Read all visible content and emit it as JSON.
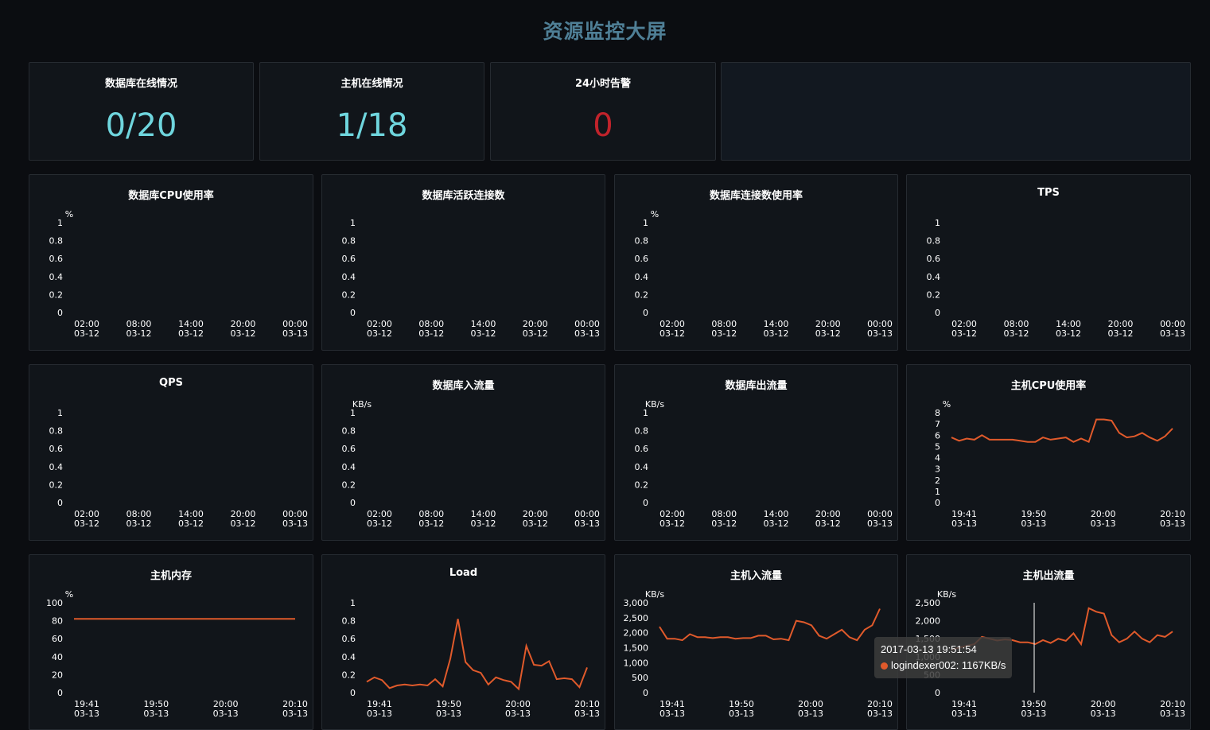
{
  "page": {
    "title": "资源监控大屏"
  },
  "colors": {
    "accent": "#4f7f96",
    "stat_cyan": "#6fd6de",
    "stat_red": "#c1232b",
    "series": "#e05a2b"
  },
  "stats": [
    {
      "label": "数据库在线情况",
      "value": "0/20",
      "color": "#6fd6de"
    },
    {
      "label": "主机在线情况",
      "value": "1/18",
      "color": "#6fd6de"
    },
    {
      "label": "24小时告警",
      "value": "0",
      "color": "#c1232b"
    }
  ],
  "tooltip": {
    "time": "2017-03-13 19:51:54",
    "series": "logindexer002",
    "value": "1167KB/s"
  },
  "chart_data": [
    {
      "type": "line",
      "title": "数据库CPU使用率",
      "unit": "%",
      "y_ticks": [
        "0",
        "0.2",
        "0.4",
        "0.6",
        "0.8",
        "1"
      ],
      "ylim": [
        0,
        1
      ],
      "x_ticks": [
        [
          "02:00",
          "03-12"
        ],
        [
          "08:00",
          "03-12"
        ],
        [
          "14:00",
          "03-12"
        ],
        [
          "20:00",
          "03-12"
        ],
        [
          "00:00",
          "03-13"
        ]
      ],
      "series": []
    },
    {
      "type": "line",
      "title": "数据库活跃连接数",
      "unit": "",
      "y_ticks": [
        "0",
        "0.2",
        "0.4",
        "0.6",
        "0.8",
        "1"
      ],
      "ylim": [
        0,
        1
      ],
      "x_ticks": [
        [
          "02:00",
          "03-12"
        ],
        [
          "08:00",
          "03-12"
        ],
        [
          "14:00",
          "03-12"
        ],
        [
          "20:00",
          "03-12"
        ],
        [
          "00:00",
          "03-13"
        ]
      ],
      "series": []
    },
    {
      "type": "line",
      "title": "数据库连接数使用率",
      "unit": "%",
      "y_ticks": [
        "0",
        "0.2",
        "0.4",
        "0.6",
        "0.8",
        "1"
      ],
      "ylim": [
        0,
        1
      ],
      "x_ticks": [
        [
          "02:00",
          "03-12"
        ],
        [
          "08:00",
          "03-12"
        ],
        [
          "14:00",
          "03-12"
        ],
        [
          "20:00",
          "03-12"
        ],
        [
          "00:00",
          "03-13"
        ]
      ],
      "series": []
    },
    {
      "type": "line",
      "title": "TPS",
      "unit": "",
      "y_ticks": [
        "0",
        "0.2",
        "0.4",
        "0.6",
        "0.8",
        "1"
      ],
      "ylim": [
        0,
        1
      ],
      "x_ticks": [
        [
          "02:00",
          "03-12"
        ],
        [
          "08:00",
          "03-12"
        ],
        [
          "14:00",
          "03-12"
        ],
        [
          "20:00",
          "03-12"
        ],
        [
          "00:00",
          "03-13"
        ]
      ],
      "series": []
    },
    {
      "type": "line",
      "title": "QPS",
      "unit": "",
      "y_ticks": [
        "0",
        "0.2",
        "0.4",
        "0.6",
        "0.8",
        "1"
      ],
      "ylim": [
        0,
        1
      ],
      "x_ticks": [
        [
          "02:00",
          "03-12"
        ],
        [
          "08:00",
          "03-12"
        ],
        [
          "14:00",
          "03-12"
        ],
        [
          "20:00",
          "03-12"
        ],
        [
          "00:00",
          "03-13"
        ]
      ],
      "series": []
    },
    {
      "type": "line",
      "title": "数据库入流量",
      "unit": "KB/s",
      "y_ticks": [
        "0",
        "0.2",
        "0.4",
        "0.6",
        "0.8",
        "1"
      ],
      "ylim": [
        0,
        1
      ],
      "x_ticks": [
        [
          "02:00",
          "03-12"
        ],
        [
          "08:00",
          "03-12"
        ],
        [
          "14:00",
          "03-12"
        ],
        [
          "20:00",
          "03-12"
        ],
        [
          "00:00",
          "03-13"
        ]
      ],
      "series": []
    },
    {
      "type": "line",
      "title": "数据库出流量",
      "unit": "KB/s",
      "y_ticks": [
        "0",
        "0.2",
        "0.4",
        "0.6",
        "0.8",
        "1"
      ],
      "ylim": [
        0,
        1
      ],
      "x_ticks": [
        [
          "02:00",
          "03-12"
        ],
        [
          "08:00",
          "03-12"
        ],
        [
          "14:00",
          "03-12"
        ],
        [
          "20:00",
          "03-12"
        ],
        [
          "00:00",
          "03-13"
        ]
      ],
      "series": []
    },
    {
      "type": "line",
      "title": "主机CPU使用率",
      "unit": "%",
      "y_ticks": [
        "0",
        "1",
        "2",
        "3",
        "4",
        "5",
        "6",
        "7",
        "8"
      ],
      "ylim": [
        0,
        8
      ],
      "x_ticks": [
        [
          "19:41",
          "03-13"
        ],
        [
          "19:50",
          "03-13"
        ],
        [
          "20:00",
          "03-13"
        ],
        [
          "20:10",
          "03-13"
        ]
      ],
      "series": [
        {
          "values": [
            5.8,
            5.5,
            5.7,
            5.6,
            6.0,
            5.6,
            5.6,
            5.6,
            5.6,
            5.5,
            5.4,
            5.4,
            5.8,
            5.6,
            5.7,
            5.8,
            5.4,
            5.7,
            5.4,
            7.4,
            7.4,
            7.3,
            6.2,
            5.8,
            5.9,
            6.2,
            5.8,
            5.5,
            5.9,
            6.6
          ]
        }
      ]
    },
    {
      "type": "line",
      "title": "主机内存",
      "unit": "%",
      "y_ticks": [
        "0",
        "20",
        "40",
        "60",
        "80",
        "100"
      ],
      "ylim": [
        0,
        100
      ],
      "x_ticks": [
        [
          "19:41",
          "03-13"
        ],
        [
          "19:50",
          "03-13"
        ],
        [
          "20:00",
          "03-13"
        ],
        [
          "20:10",
          "03-13"
        ]
      ],
      "series": [
        {
          "values": [
            82,
            82,
            82,
            82,
            82,
            82,
            82,
            82,
            82,
            82,
            82,
            82,
            82,
            82,
            82,
            82,
            82,
            82,
            82,
            82,
            82,
            82,
            82,
            82,
            82,
            82,
            82,
            82,
            82,
            82
          ]
        }
      ]
    },
    {
      "type": "line",
      "title": "Load",
      "unit": "",
      "y_ticks": [
        "0",
        "0.2",
        "0.4",
        "0.6",
        "0.8",
        "1"
      ],
      "ylim": [
        0,
        1
      ],
      "x_ticks": [
        [
          "19:41",
          "03-13"
        ],
        [
          "19:50",
          "03-13"
        ],
        [
          "20:00",
          "03-13"
        ],
        [
          "20:10",
          "03-13"
        ]
      ],
      "series": [
        {
          "values": [
            0.12,
            0.17,
            0.14,
            0.05,
            0.08,
            0.09,
            0.08,
            0.09,
            0.08,
            0.15,
            0.07,
            0.38,
            0.82,
            0.34,
            0.25,
            0.22,
            0.09,
            0.17,
            0.14,
            0.12,
            0.04,
            0.52,
            0.31,
            0.3,
            0.35,
            0.15,
            0.16,
            0.15,
            0.06,
            0.28
          ]
        }
      ]
    },
    {
      "type": "line",
      "title": "主机入流量",
      "unit": "KB/s",
      "y_ticks": [
        "0",
        "500",
        "1,000",
        "1,500",
        "2,000",
        "2,500",
        "3,000"
      ],
      "ylim": [
        0,
        3000
      ],
      "x_ticks": [
        [
          "19:41",
          "03-13"
        ],
        [
          "19:50",
          "03-13"
        ],
        [
          "20:00",
          "03-13"
        ],
        [
          "20:10",
          "03-13"
        ]
      ],
      "series": [
        {
          "values": [
            2200,
            1800,
            1800,
            1750,
            1950,
            1850,
            1850,
            1820,
            1850,
            1850,
            1800,
            1820,
            1820,
            1900,
            1900,
            1780,
            1800,
            1750,
            2400,
            2350,
            2250,
            1900,
            1800,
            1950,
            2100,
            1850,
            1750,
            2100,
            2250,
            2800
          ]
        }
      ]
    },
    {
      "type": "line",
      "title": "主机出流量",
      "unit": "KB/s",
      "y_ticks": [
        "0",
        "500",
        "1,000",
        "1,500",
        "2,000",
        "2,500"
      ],
      "ylim": [
        0,
        2500
      ],
      "x_ticks": [
        [
          "19:41",
          "03-13"
        ],
        [
          "19:50",
          "03-13"
        ],
        [
          "20:00",
          "03-13"
        ],
        [
          "20:10",
          "03-13"
        ]
      ],
      "series": [
        {
          "values": [
            1200,
            1250,
            1300,
            1350,
            1550,
            1500,
            1450,
            1480,
            1460,
            1400,
            1400,
            1350,
            1460,
            1380,
            1500,
            1440,
            1650,
            1350,
            2350,
            2250,
            2200,
            1600,
            1400,
            1500,
            1700,
            1500,
            1400,
            1600,
            1550,
            1700
          ]
        }
      ]
    }
  ]
}
